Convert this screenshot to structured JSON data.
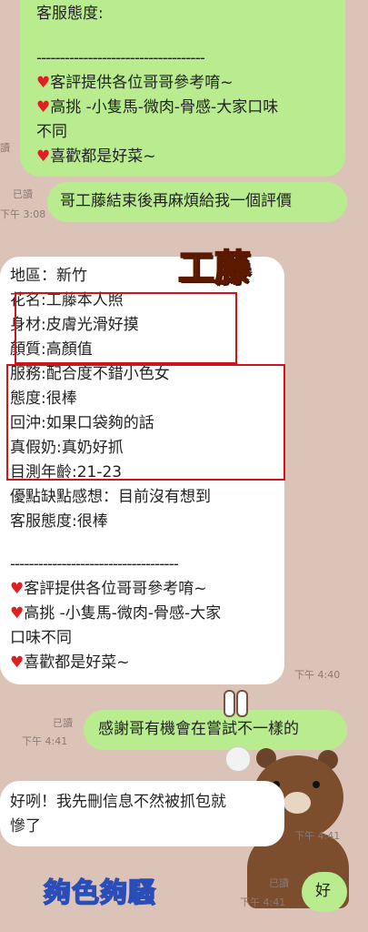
{
  "top_bubble": {
    "line1": "客服態度:",
    "divider": "------------------------------------",
    "items": [
      "客評提供各位哥哥參考唷~",
      "高挑 -小隻馬-微肉-骨感-大家口味",
      "不同",
      "喜歡都是好菜~"
    ]
  },
  "msg1": {
    "read": "已讀",
    "time": "下午 3:08",
    "text": "哥工藤結束後再麻煩給我一個評價"
  },
  "review": {
    "lines": [
      "地區：新竹",
      "花名:工藤本人照",
      "身材:皮膚光滑好摸",
      "顏質:高顏值",
      "服務:配合度不錯小色女",
      "態度:很棒",
      "回沖:如果口袋夠的話",
      "真假奶:真奶好抓",
      "目測年齡:21-23",
      "優點缺點感想：目前沒有想到",
      "客服態度:很棒"
    ],
    "divider": "------------------------------------",
    "items": [
      "客評提供各位哥哥參考唷~",
      "高挑 -小隻馬-微肉-骨感-大家",
      "口味不同",
      "喜歡都是好菜~"
    ],
    "time": "下午 4:40"
  },
  "sticker": {
    "text": "工藤"
  },
  "msg2": {
    "read": "已讀",
    "time": "下午 4:41",
    "text": "感謝哥有機會在嘗試不一樣的"
  },
  "msg3": {
    "lines": [
      "好咧！我先刪信息不然被抓包就",
      "慘了"
    ],
    "time": "下午 4:41"
  },
  "msg4": {
    "read": "已讀",
    "time": "下午 4:41",
    "text": "好"
  },
  "watermark": "夠色夠騷"
}
